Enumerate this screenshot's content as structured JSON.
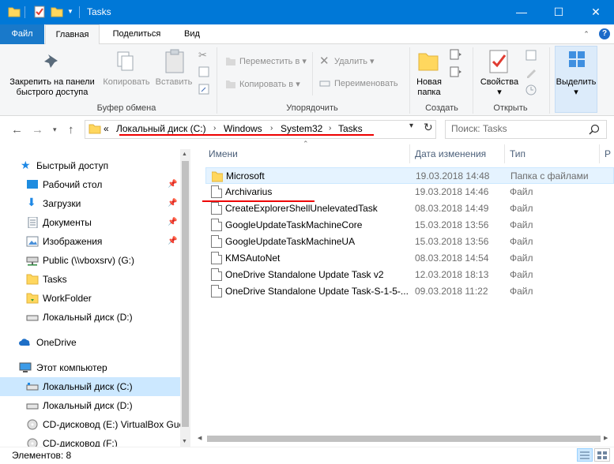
{
  "window": {
    "title": "Tasks"
  },
  "ribbon_tabs": [
    "Файл",
    "Главная",
    "Поделиться",
    "Вид"
  ],
  "ribbon": {
    "clipboard": {
      "pin": "Закрепить на панели быстрого доступа",
      "copy": "Копировать",
      "paste": "Вставить",
      "group": "Буфер обмена"
    },
    "organize": {
      "move": "Переместить в",
      "copy_to": "Копировать в",
      "delete": "Удалить",
      "rename": "Переименовать",
      "group": "Упорядочить"
    },
    "create": {
      "new_folder": "Новая папка",
      "group": "Создать"
    },
    "open": {
      "properties": "Свойства",
      "group": "Открыть"
    },
    "select": {
      "select_label": "Выделить"
    }
  },
  "address": {
    "breadcrumbs": [
      "Локальный диск (C:)",
      "Windows",
      "System32",
      "Tasks"
    ],
    "overflow": "«"
  },
  "search": {
    "placeholder": "Поиск: Tasks"
  },
  "nav": {
    "items": [
      {
        "label": "Быстрый доступ",
        "icon": "star-icon"
      },
      {
        "label": "Рабочий стол",
        "icon": "desktop-icon",
        "pinned": true
      },
      {
        "label": "Загрузки",
        "icon": "download-icon",
        "pinned": true
      },
      {
        "label": "Документы",
        "icon": "documents-icon",
        "pinned": true
      },
      {
        "label": "Изображения",
        "icon": "pictures-icon",
        "pinned": true
      },
      {
        "label": "Public (\\\\vboxsrv) (G:)",
        "icon": "network-drive-icon"
      },
      {
        "label": "Tasks",
        "icon": "folder-icon"
      },
      {
        "label": "WorkFolder",
        "icon": "folder-icon"
      },
      {
        "label": "Локальный диск (D:)",
        "icon": "drive-icon"
      },
      {
        "label": "OneDrive",
        "icon": "cloud-icon"
      },
      {
        "label": "Этот компьютер",
        "icon": "computer-icon"
      },
      {
        "label": "Локальный диск (C:)",
        "icon": "drive-icon",
        "selected": true
      },
      {
        "label": "Локальный диск (D:)",
        "icon": "drive-icon"
      },
      {
        "label": "CD-дисковод (E:) VirtualBox Gue",
        "icon": "cd-icon"
      },
      {
        "label": "CD-дисковод (F:)",
        "icon": "cd-icon"
      }
    ]
  },
  "list": {
    "columns": [
      "Имени",
      "Дата изменения",
      "Тип",
      "Р"
    ],
    "rows": [
      {
        "name": "Microsoft",
        "date": "19.03.2018 14:48",
        "type": "Папка с файлами",
        "icon": "folder-icon"
      },
      {
        "name": "Archivarius",
        "date": "19.03.2018 14:46",
        "type": "Файл",
        "icon": "file-icon"
      },
      {
        "name": "CreateExplorerShellUnelevatedTask",
        "date": "08.03.2018 14:49",
        "type": "Файл",
        "icon": "file-icon"
      },
      {
        "name": "GoogleUpdateTaskMachineCore",
        "date": "15.03.2018 13:56",
        "type": "Файл",
        "icon": "file-icon"
      },
      {
        "name": "GoogleUpdateTaskMachineUA",
        "date": "15.03.2018 13:56",
        "type": "Файл",
        "icon": "file-icon"
      },
      {
        "name": "KMSAutoNet",
        "date": "08.03.2018 14:54",
        "type": "Файл",
        "icon": "file-icon"
      },
      {
        "name": "OneDrive Standalone Update Task v2",
        "date": "12.03.2018 18:13",
        "type": "Файл",
        "icon": "file-icon"
      },
      {
        "name": "OneDrive Standalone Update Task-S-1-5-...",
        "date": "09.03.2018 11:22",
        "type": "Файл",
        "icon": "file-icon"
      }
    ]
  },
  "status": {
    "items_count": "Элементов: 8"
  },
  "colors": {
    "accent": "#0078d7",
    "selection": "#cce8ff",
    "annotation": "#e00000"
  }
}
